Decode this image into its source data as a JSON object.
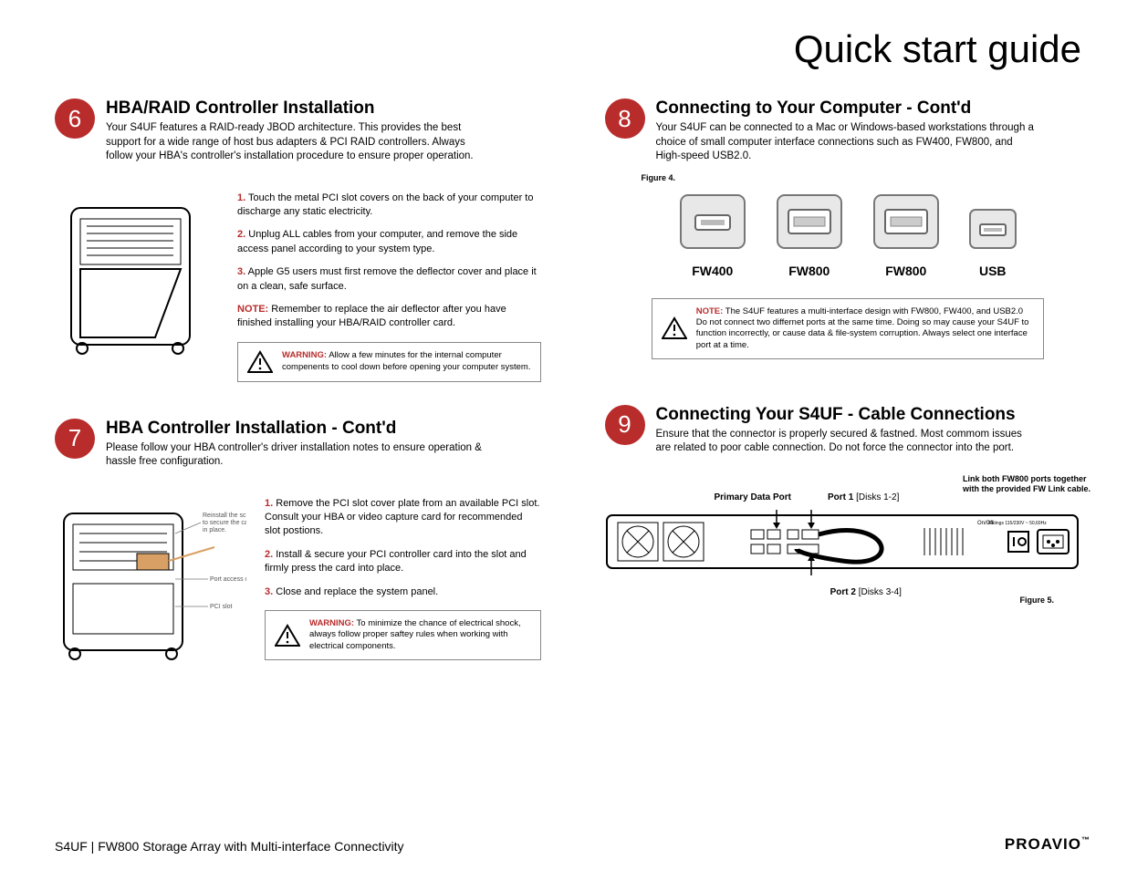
{
  "page_title": "Quick start guide",
  "sections": {
    "s6": {
      "num": "6",
      "title": "HBA/RAID Controller Installation",
      "desc": "Your S4UF features a RAID-ready JBOD architecture. This provides the best support for a wide range of host bus adapters & PCI RAID controllers. Always follow your HBA's controller's installation procedure to ensure proper operation.",
      "steps": [
        "Touch the metal PCI slot covers on the back of your computer to discharge any static electricity.",
        "Unplug ALL cables from your computer, and remove the side access panel according to your system type.",
        "Apple G5 users must first remove the deflector cover and place it on a clean, safe surface."
      ],
      "note_label": "NOTE:",
      "note": "Remember to replace the air deflector after you have finished installing your HBA/RAID controller card.",
      "warn_label": "WARNING:",
      "warn": "Allow a few minutes for the internal computer compenents to cool down before opening your computer system."
    },
    "s7": {
      "num": "7",
      "title": "HBA Controller Installation - Cont'd",
      "desc": "Please follow your HBA controller's driver installation notes to ensure operation & hassle free configuration.",
      "steps": [
        "Remove the PCI slot cover plate from an available PCI slot. Consult your HBA or video capture card for recommended slot postions.",
        "Install & secure your PCI controller card into the slot and firmly press the card into place.",
        "Close and replace the system panel."
      ],
      "callouts": {
        "a": "Reinstall the screw to secure the card in place.",
        "b": "Port access opening",
        "c": "PCI slot"
      },
      "warn_label": "WARNING:",
      "warn": "To minimize the chance of electrical shock, always follow proper saftey rules when working with electrical components."
    },
    "s8": {
      "num": "8",
      "title": "Connecting to Your Computer - Cont'd",
      "desc": "Your S4UF can be connected to a Mac or Windows-based workstations through a choice of small computer interface connections such as FW400, FW800, and High-speed USB2.0.",
      "fig": "Figure 4.",
      "ports": [
        "FW400",
        "FW800",
        "FW800",
        "USB"
      ],
      "note_label": "NOTE:",
      "note": "The S4UF features a multi-interface design with FW800, FW400,  and USB2.0 Do not connect two  differnet ports at the same time. Doing so may cause your S4UF to function incorrectly, or cause data & file-system corruption. Always select one interface port at a time."
    },
    "s9": {
      "num": "9",
      "title": "Connecting Your S4UF - Cable Connections",
      "desc": "Ensure that the connector is properly secured & fastned. Most commom issues are related to poor cable connection. Do not force the connector into the port.",
      "labels": {
        "primary": "Primary Data Port",
        "port1": "Port 1",
        "port1_sub": "[Disks 1-2]",
        "link_note": "Link both FW800 ports together with the provided FW Link cable.",
        "port2": "Port 2",
        "port2_sub": "[Disks 3-4]",
        "fig": "Figure 5.",
        "rating": "Ratings 115/230V ~ 50,60Hz",
        "onoff": "On/Off"
      }
    }
  },
  "footer": {
    "product": "S4UF | FW800 Storage Array with Multi-interface Connectivity",
    "brand": "PROAVIO"
  }
}
